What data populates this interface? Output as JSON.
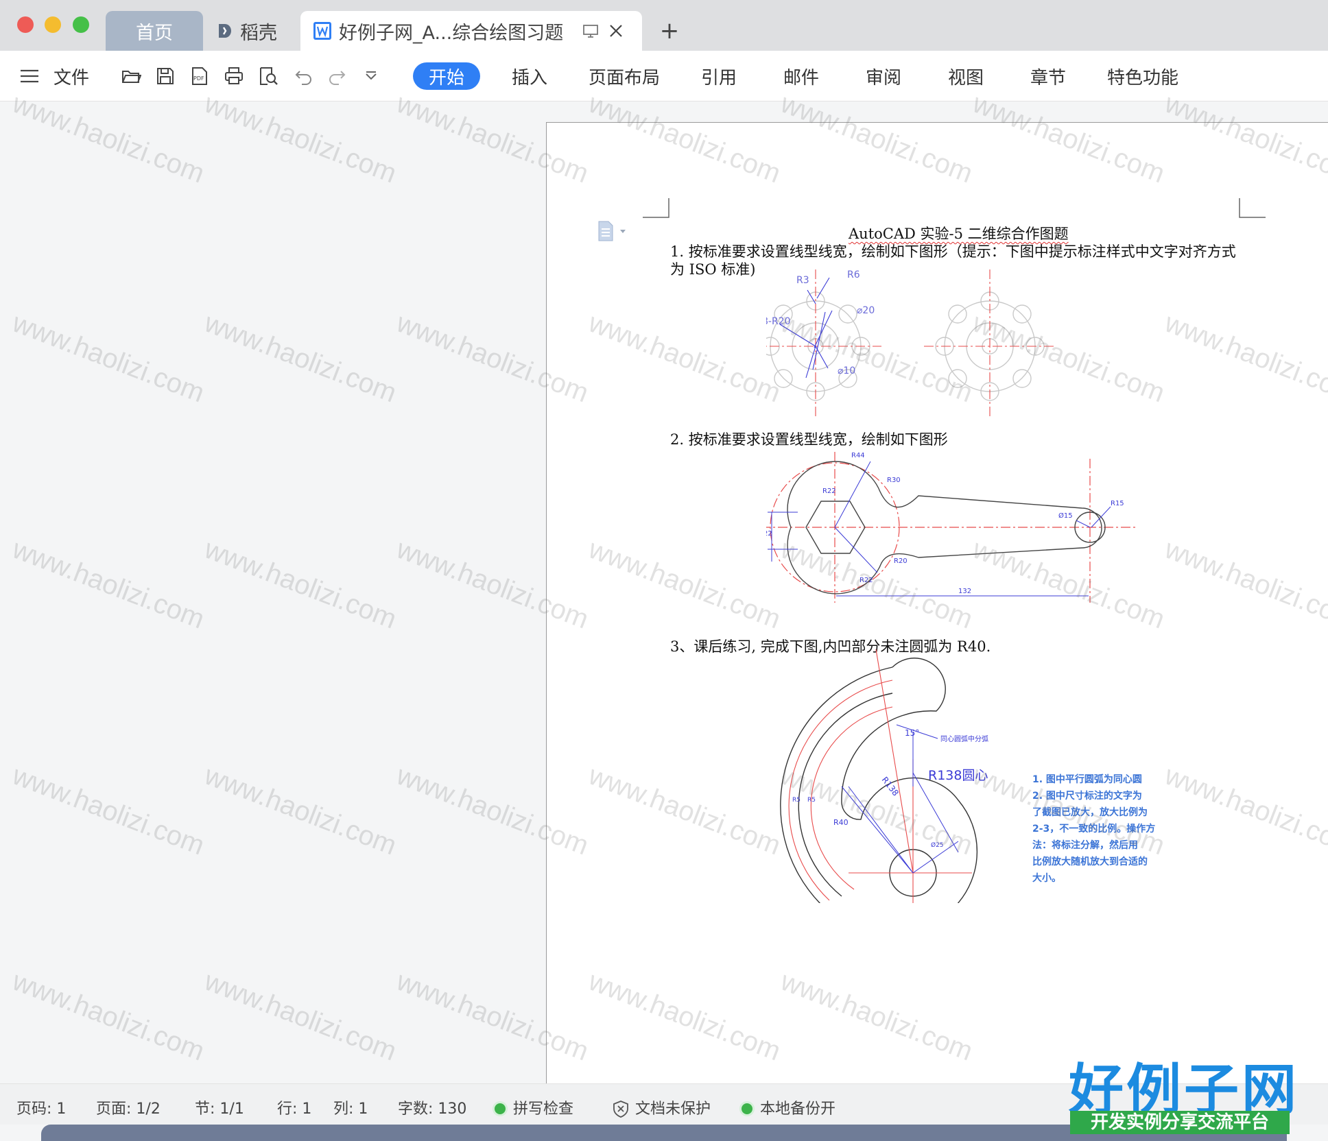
{
  "titlebar": {
    "tabs": [
      {
        "label": "首页"
      },
      {
        "label": "稻壳"
      },
      {
        "label": "好例子网_A...综合绘图习题"
      }
    ],
    "new_tab": "+"
  },
  "toolbar": {
    "file_menu": "文件",
    "ribbon_tabs": [
      "开始",
      "插入",
      "页面布局",
      "引用",
      "邮件",
      "审阅",
      "视图",
      "章节",
      "特色功能"
    ],
    "active_tab": "开始",
    "accent": "#2f7ff5"
  },
  "document": {
    "title": "AutoCAD 实验-5 二维综合作图题",
    "q1": "1. 按标准要求设置线型线宽，绘制如下图形（提示：下图中提示标注样式中文字对齐方式",
    "q1b": "为 ISO 标准)",
    "q2": "2. 按标准要求设置线型线宽，绘制如下图形",
    "q3": "3、课后练习, 完成下图,内凹部分未注圆弧为 R40.",
    "fig1": {
      "r3": "R3",
      "r6": "R6",
      "d20": "⌀20",
      "r20": "8-R20",
      "d10": "⌀10"
    },
    "fig2": {
      "r44": "R44",
      "r30": "R30",
      "r22a": "R22",
      "r22b": "R22",
      "r15": "R15",
      "d15": "Ø15",
      "r20": "R20",
      "h22": "22",
      "w132": "132"
    },
    "fig3": {
      "angle": "15°",
      "concentric": "同心圆弧中分弧",
      "r138": "R138",
      "r138c": "R138圆心",
      "r40": "R40",
      "r5a": "R5",
      "r5b": "R5",
      "d25": "Ø25",
      "notes": [
        "1. 图中平行圆弧为同心圆",
        "2. 图中尺寸标注的文字为",
        "了截图已放大，放大比例为",
        "2-3，不一致的比例。操作方",
        "法：将标注分解，然后用",
        "比例放大随机放大到合适的",
        "大小。"
      ]
    }
  },
  "statusbar": {
    "page_code": "页码: 1",
    "pages": "页面: 1/2",
    "section": "节: 1/1",
    "row": "行: 1",
    "col": "列: 1",
    "words": "字数: 130",
    "spell": "拼写检查",
    "protect": "文档未保护",
    "backup": "本地备份开"
  },
  "watermark": {
    "text": "www.haolizi.com"
  },
  "logo": {
    "title": "好例子网",
    "subtitle": "开发实例分享交流平台"
  }
}
